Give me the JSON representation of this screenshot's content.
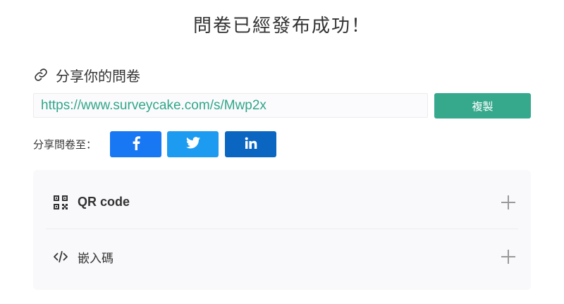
{
  "page": {
    "title": "問卷已經發布成功！"
  },
  "share": {
    "heading": "分享你的問卷",
    "heading_icon": "link-icon",
    "url": "https://www.surveycake.com/s/Mwp2x",
    "copy_label": "複製",
    "share_to_label": "分享問卷至：",
    "networks": [
      {
        "name": "facebook",
        "icon": "facebook-icon",
        "color": "#1877f2"
      },
      {
        "name": "twitter",
        "icon": "twitter-icon",
        "color": "#1d9bf0"
      },
      {
        "name": "linkedin",
        "icon": "linkedin-icon",
        "color": "#0b66c2"
      }
    ]
  },
  "accordion": {
    "items": [
      {
        "label": "QR code",
        "icon": "qr-code-icon",
        "expanded": false
      },
      {
        "label": "嵌入碼",
        "icon": "code-icon",
        "expanded": false
      }
    ]
  },
  "colors": {
    "accent": "#36a98d",
    "url_text": "#31a68a"
  }
}
